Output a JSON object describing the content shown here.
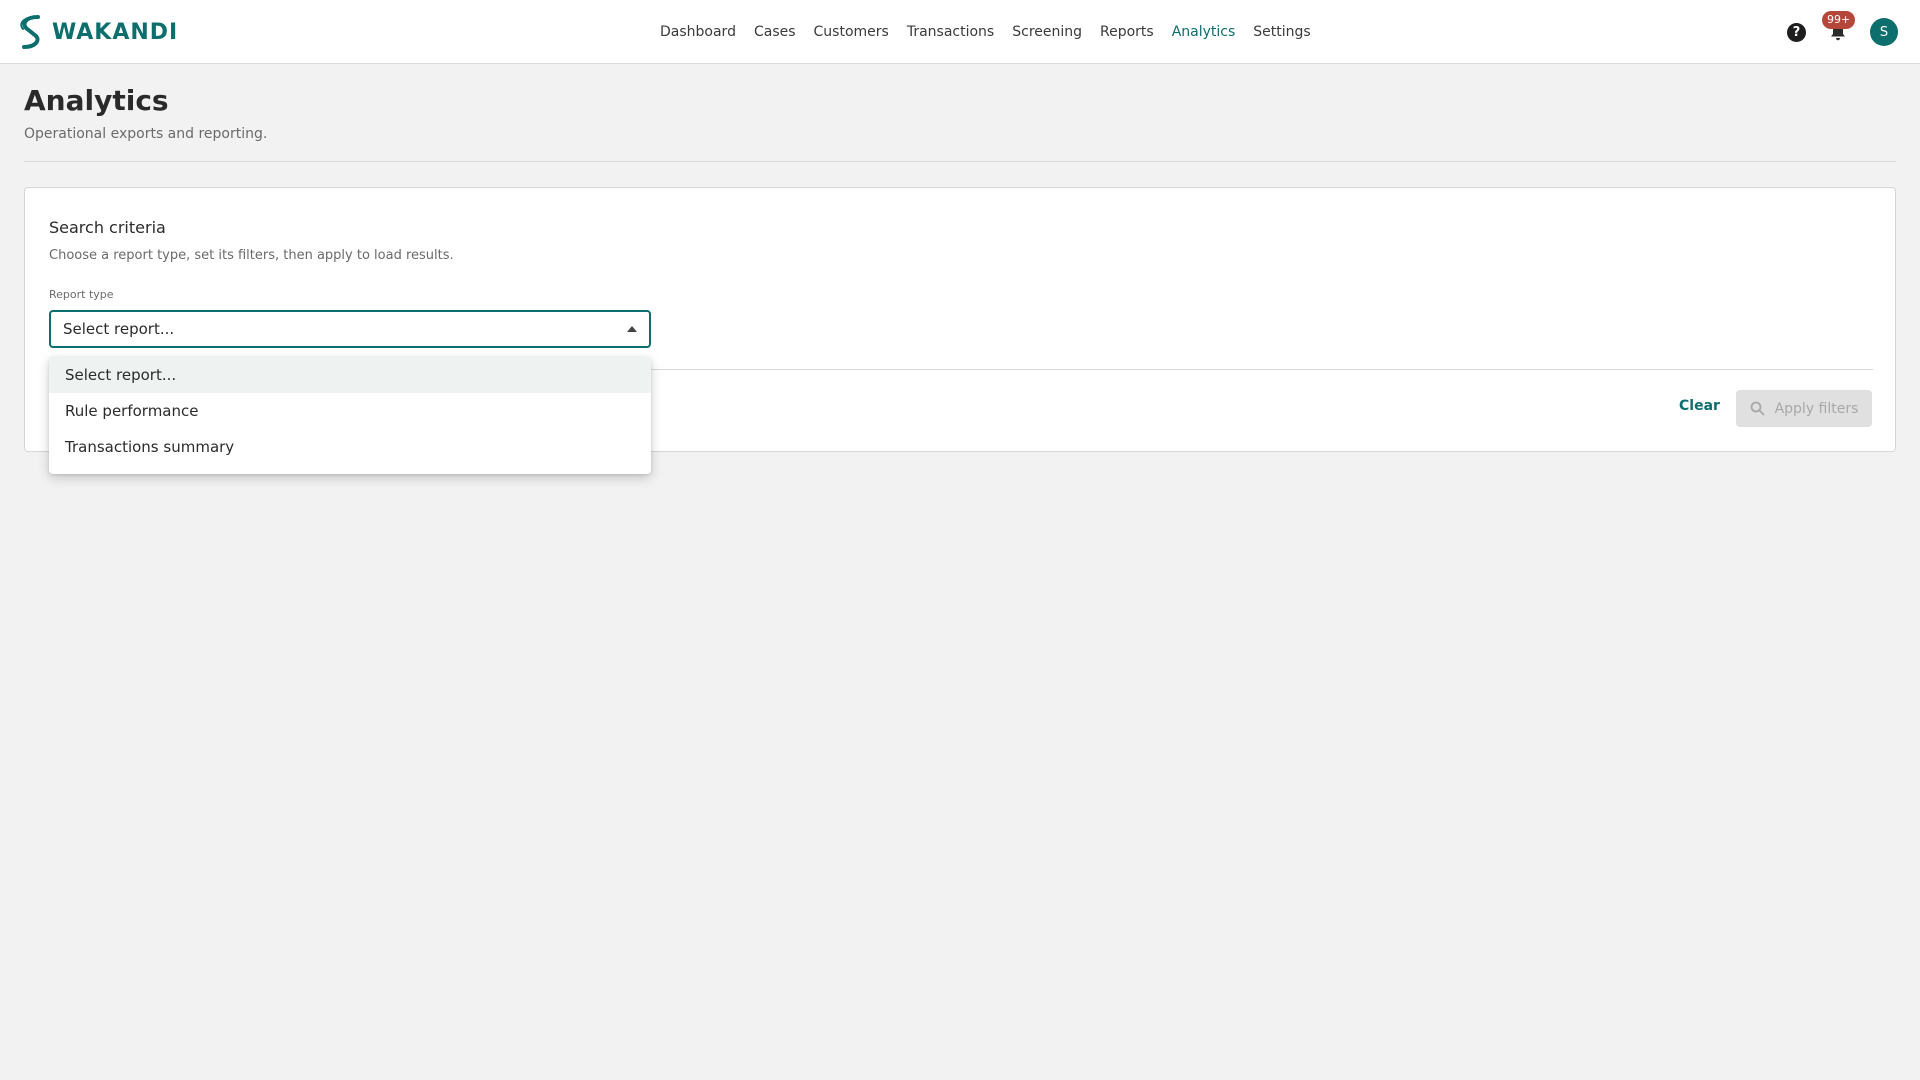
{
  "app": {
    "logo_text": "WAKANDI"
  },
  "nav": {
    "items": [
      {
        "label": "Dashboard",
        "active": false
      },
      {
        "label": "Cases",
        "active": false
      },
      {
        "label": "Customers",
        "active": false
      },
      {
        "label": "Transactions",
        "active": false
      },
      {
        "label": "Screening",
        "active": false
      },
      {
        "label": "Reports",
        "active": false
      },
      {
        "label": "Analytics",
        "active": true
      },
      {
        "label": "Settings",
        "active": false
      }
    ]
  },
  "top_actions": {
    "help_icon": "question-circle-icon",
    "bell_icon": "bell-icon",
    "notification_badge": "99+",
    "avatar_initial": "S"
  },
  "page": {
    "title": "Analytics",
    "subtitle": "Operational exports and reporting."
  },
  "search_card": {
    "title": "Search criteria",
    "description": "Choose a report type, set its filters, then apply to load results.",
    "report_type_label": "Report type",
    "report_type_value": "Select report...",
    "options": [
      "Select report...",
      "Rule performance",
      "Transactions summary"
    ],
    "selected_option_index": 0,
    "clear_label": "Clear",
    "apply_label": "Apply filters",
    "apply_enabled": false
  },
  "colors": {
    "accent": "#0d6e6e",
    "badge": "#b5473a",
    "background": "#f2f2f2"
  }
}
